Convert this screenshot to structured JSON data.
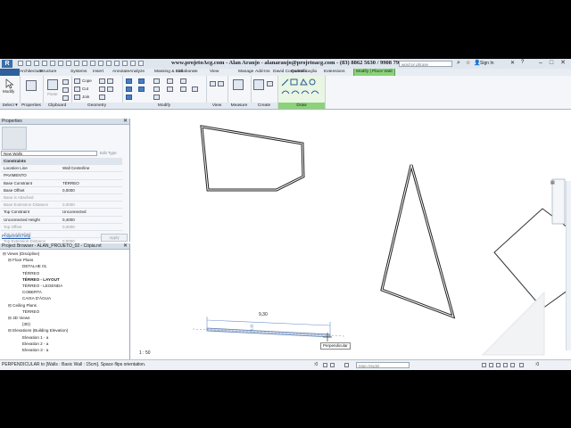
{
  "title_bar": {
    "title": "www.projetoAcg.com - Alan Araujo - alanaraujo@projetoacg.com - (83) 8862 5630 / 9908 7970",
    "search_placeholder": "word or phrase",
    "sign_in": "Sign In",
    "logo_letter": "R"
  },
  "tabs": [
    "Architecture",
    "Structure",
    "Systems",
    "Insert",
    "Annotate",
    "Analyze",
    "Massing & Site",
    "Collaborate",
    "View",
    "Manage",
    "Add-Ins",
    "David Consultoria",
    "Quantificação",
    "Extensions",
    "Modify | Place Wall"
  ],
  "ribbon": {
    "modify_label": "Modify",
    "select_label": "Select ▾",
    "panels": [
      "Properties",
      "Clipboard",
      "Geometry",
      "Modify",
      "View",
      "Measure",
      "Create",
      "Draw"
    ],
    "small_labels": [
      "Cope",
      "Cut",
      "Join",
      "Paste"
    ]
  },
  "properties": {
    "title": "Properties",
    "type_selector": "New Walls",
    "edit_type": "Edit Type",
    "rows": [
      {
        "k": "Constraints",
        "v": "",
        "group": true
      },
      {
        "k": "Location Line",
        "v": "Wall Centerline"
      },
      {
        "k": "PAVIMENTO",
        "v": ""
      },
      {
        "k": "Base Constraint",
        "v": "TÉRREO"
      },
      {
        "k": "Base Offset",
        "v": "0,0000"
      },
      {
        "k": "Base is Attached",
        "v": "",
        "dim": true
      },
      {
        "k": "Base Extension Distance",
        "v": "0,0000",
        "dim": true
      },
      {
        "k": "Top Constraint",
        "v": "Unconnected"
      },
      {
        "k": "Unconnected Height",
        "v": "0,4000"
      },
      {
        "k": "Top Offset",
        "v": "0,0000",
        "dim": true
      },
      {
        "k": "Top is Attached",
        "v": "",
        "dim": true
      },
      {
        "k": "Top Extension Distance",
        "v": "0,0000",
        "dim": true
      }
    ],
    "help": "Properties help",
    "apply": "Apply"
  },
  "browser": {
    "title": "Project Browser - ALAN_PROJETO_02 - Cópia.rvt",
    "items": [
      {
        "t": "⊟ Views (Discipline)",
        "lvl": 0
      },
      {
        "t": "⊟ Floor Plans",
        "lvl": 1
      },
      {
        "t": "DETALHE 01",
        "lvl": 2
      },
      {
        "t": "TÉRREO",
        "lvl": 2
      },
      {
        "t": "TÉRREO - LAYOUT",
        "lvl": 2,
        "bold": true
      },
      {
        "t": "TÉRREO - LEGENDA",
        "lvl": 2
      },
      {
        "t": "COBERTA",
        "lvl": 2
      },
      {
        "t": "CAIXA D'ÁGUA",
        "lvl": 2
      },
      {
        "t": "⊟ Ceiling Plans",
        "lvl": 1
      },
      {
        "t": "TÉRREO",
        "lvl": 2
      },
      {
        "t": "⊟ 3D Views",
        "lvl": 1
      },
      {
        "t": "{3D}",
        "lvl": 2
      },
      {
        "t": "⊟ Elevations (Building Elevation)",
        "lvl": 1
      },
      {
        "t": "Elevation 1 - a",
        "lvl": 2
      },
      {
        "t": "Elevation 2 - a",
        "lvl": 2
      },
      {
        "t": "Elevation 3 - a",
        "lvl": 2
      }
    ]
  },
  "canvas": {
    "dimension_value": "9,30",
    "wall_height_label": "0,15",
    "tooltip": "Perpendicular"
  },
  "status": {
    "text": "PERPENDICULAR to [Walls : Basic Wall : 15cm]. Space flips orientation.",
    "scale": "1 : 50",
    "model": "Main Model",
    "zero": ":0"
  }
}
